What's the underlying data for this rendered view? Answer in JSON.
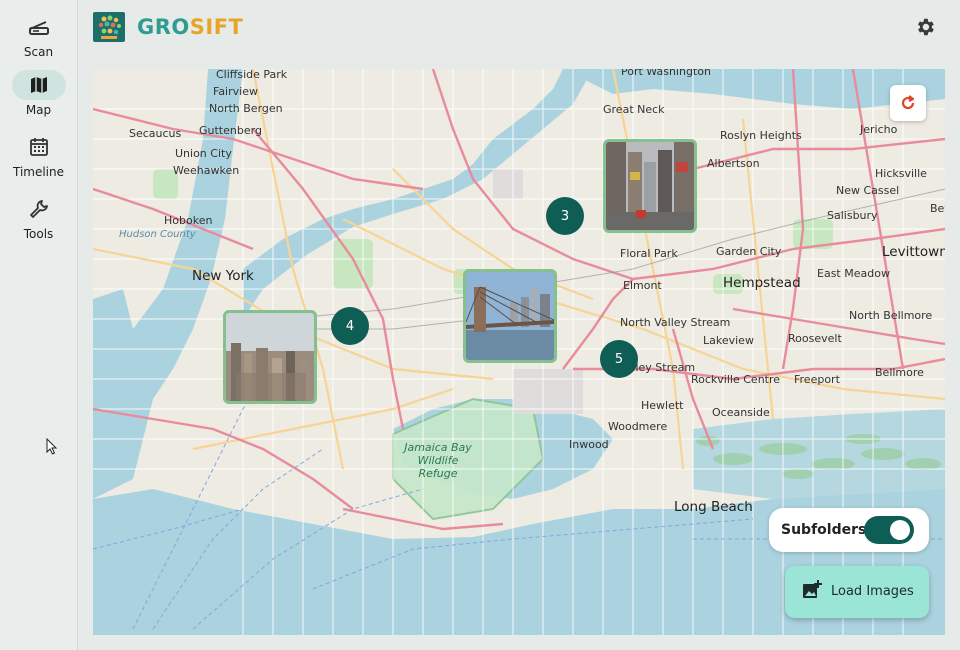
{
  "app": {
    "brand_part1": "GRO",
    "brand_part2": "SIFT"
  },
  "sidebar": {
    "items": [
      {
        "label": "Scan",
        "icon": "scanner-icon",
        "active": false
      },
      {
        "label": "Map",
        "icon": "map-icon",
        "active": true
      },
      {
        "label": "Timeline",
        "icon": "calendar-icon",
        "active": false
      },
      {
        "label": "Tools",
        "icon": "wrench-icon",
        "active": false
      }
    ]
  },
  "map": {
    "place_labels": [
      "Cliffside Park",
      "Fairview",
      "North Bergen",
      "Guttenberg",
      "Secaucus",
      "Union City",
      "Weehawken",
      "Hoboken",
      "Hudson County",
      "New York",
      "Great Neck",
      "Roslyn Heights",
      "Albertson",
      "Jericho",
      "Hicksville",
      "New Cassel",
      "Salisbury",
      "Levittown",
      "Garden City",
      "Floral Park",
      "Elmont",
      "Hempstead",
      "East Meadow",
      "North Bellmore",
      "North Valley Stream",
      "Lakeview",
      "Roosevelt",
      "Rockville Centre",
      "Freeport",
      "Bellmore",
      "Valley Stream",
      "Hewlett",
      "Oceanside",
      "Woodmere",
      "Inwood",
      "Long Beach",
      "Jamaica Bay Wildlife Refuge",
      "Port Washington",
      "Bet"
    ],
    "clusters": [
      {
        "count": "3"
      },
      {
        "count": "4"
      },
      {
        "count": "5"
      }
    ],
    "photos": [
      {
        "name": "times-square-photo"
      },
      {
        "name": "brooklyn-bridge-photo"
      },
      {
        "name": "manhattan-skyline-photo"
      }
    ]
  },
  "controls": {
    "subfolders_label": "Subfolders",
    "subfolders_on": true,
    "load_images_label": "Load Images"
  },
  "colors": {
    "accent": "#0f5e55",
    "brand_teal": "#2f9c8f",
    "brand_orange": "#e8a425",
    "load_button": "#9be5d7",
    "photo_border": "#86c08e",
    "refresh": "#e0452c"
  }
}
